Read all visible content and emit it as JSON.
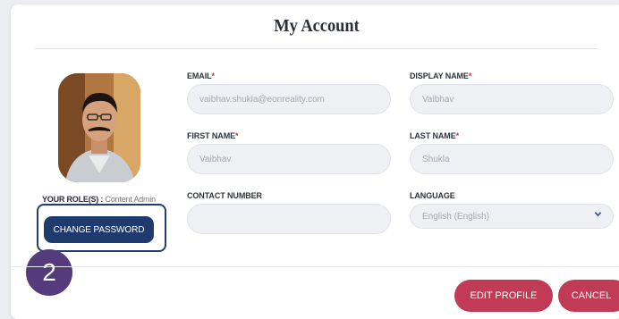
{
  "header": {
    "title": "My Account"
  },
  "profile": {
    "role_label": "YOUR ROLE(S) :",
    "role_value": "Content Admin",
    "change_password_label": "CHANGE PASSWORD"
  },
  "annotation": {
    "step_number": "2"
  },
  "form": {
    "email": {
      "label": "EMAIL",
      "required_mark": "*",
      "value": "vaibhav.shukla@eonreality.com"
    },
    "display_name": {
      "label": "DISPLAY NAME",
      "required_mark": "*",
      "value": "Vaibhav"
    },
    "first_name": {
      "label": "FIRST NAME",
      "required_mark": "*",
      "value": "Vaibhav"
    },
    "last_name": {
      "label": "LAST NAME",
      "required_mark": "*",
      "value": "Shukla"
    },
    "contact_number": {
      "label": "CONTACT NUMBER",
      "value": ""
    },
    "language": {
      "label": "LANGUAGE",
      "value": "English (English)"
    }
  },
  "actions": {
    "edit_label": "EDIT PROFILE",
    "cancel_label": "CANCEL"
  },
  "colors": {
    "primary_navy": "#1f3b6e",
    "accent_red": "#c13b57",
    "badge_purple": "#553b7b"
  },
  "icons": {
    "dropdown": "chevron-down-icon"
  }
}
